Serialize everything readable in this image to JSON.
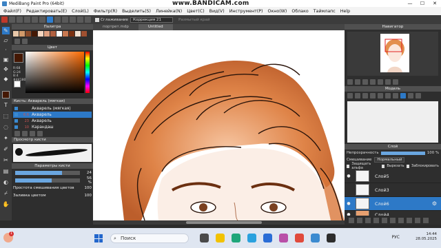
{
  "window": {
    "title": "MediBang Paint Pro (64bit)",
    "watermark": "www.BANDICAM.com",
    "min": "—",
    "max": "☐",
    "close": "✕"
  },
  "menu": [
    "Файл(F)",
    "Редактировать(E)",
    "Слой(L)",
    "Фильтр(R)",
    "Выделить(S)",
    "Линейка(N)",
    "Цвет(C)",
    "Вид(V)",
    "Инструмент(P)",
    "Окно(W)",
    "Облако",
    "Таймлапс",
    "Help"
  ],
  "toolbar": {
    "smoothing_label": "Сглаживание",
    "correction_label": "Коррекция 21",
    "smooth_edge_label": "Размытый край"
  },
  "palette": {
    "title": "Палитра",
    "swatches": [
      "#e9c8a8",
      "#d29a6a",
      "#8a4a28",
      "#441804",
      "#f5d6c0",
      "#e0a080",
      "#b06040",
      "#ffffff",
      "#c87850",
      "#7a3010",
      "#f0e0d0",
      "#a05030"
    ]
  },
  "color": {
    "title": "Цвет",
    "r": "R:68",
    "g": "G:24",
    "b": "B:4",
    "hex": "#441804"
  },
  "brush": {
    "title": "Кисть: Акварель (мягкая)",
    "items": [
      {
        "size": "",
        "name": "Акварель (мягкая)",
        "selected": true
      },
      {
        "size": "6.6",
        "name": "Акварель",
        "selected": false
      },
      {
        "size": "23",
        "name": "Акварель",
        "selected": false
      },
      {
        "size": "10",
        "name": "Карандаш",
        "selected": false
      }
    ]
  },
  "brush_preview": {
    "title": "Просмотр кисти"
  },
  "brush_params": {
    "title": "Параметры кисти",
    "size_value": "24",
    "opacity_value": "56 %",
    "blend_label": "Простота смешивания цветов",
    "blend_value": "100",
    "fill_label": "Заливка цветом",
    "fill_value": "100",
    "size_level": 0.72,
    "opacity_level": 0.56
  },
  "tabs": [
    "портрет.mdp",
    "Untitled"
  ],
  "navigator": {
    "title": "Навигатор"
  },
  "model": {
    "title": "Модель"
  },
  "layers": {
    "title": "Слой",
    "opacity_label": "Непрозрачность",
    "opacity_value": "100 %",
    "blend_label": "Смешивание",
    "blend_value": "Нормальный",
    "protect_alpha": "Защищать альфа",
    "clip": "Вырезать",
    "lock": "Заблокировать",
    "items": [
      {
        "name": "Слой5",
        "selected": false
      },
      {
        "name": "Слой3",
        "selected": false
      },
      {
        "name": "Слой6",
        "selected": true
      },
      {
        "name": "Слой4",
        "selected": false
      }
    ]
  },
  "taskbar": {
    "notification_count": "1",
    "search_placeholder": "Поиск",
    "lang": "РУС",
    "time": "14:44",
    "date": "28.05.2025"
  }
}
